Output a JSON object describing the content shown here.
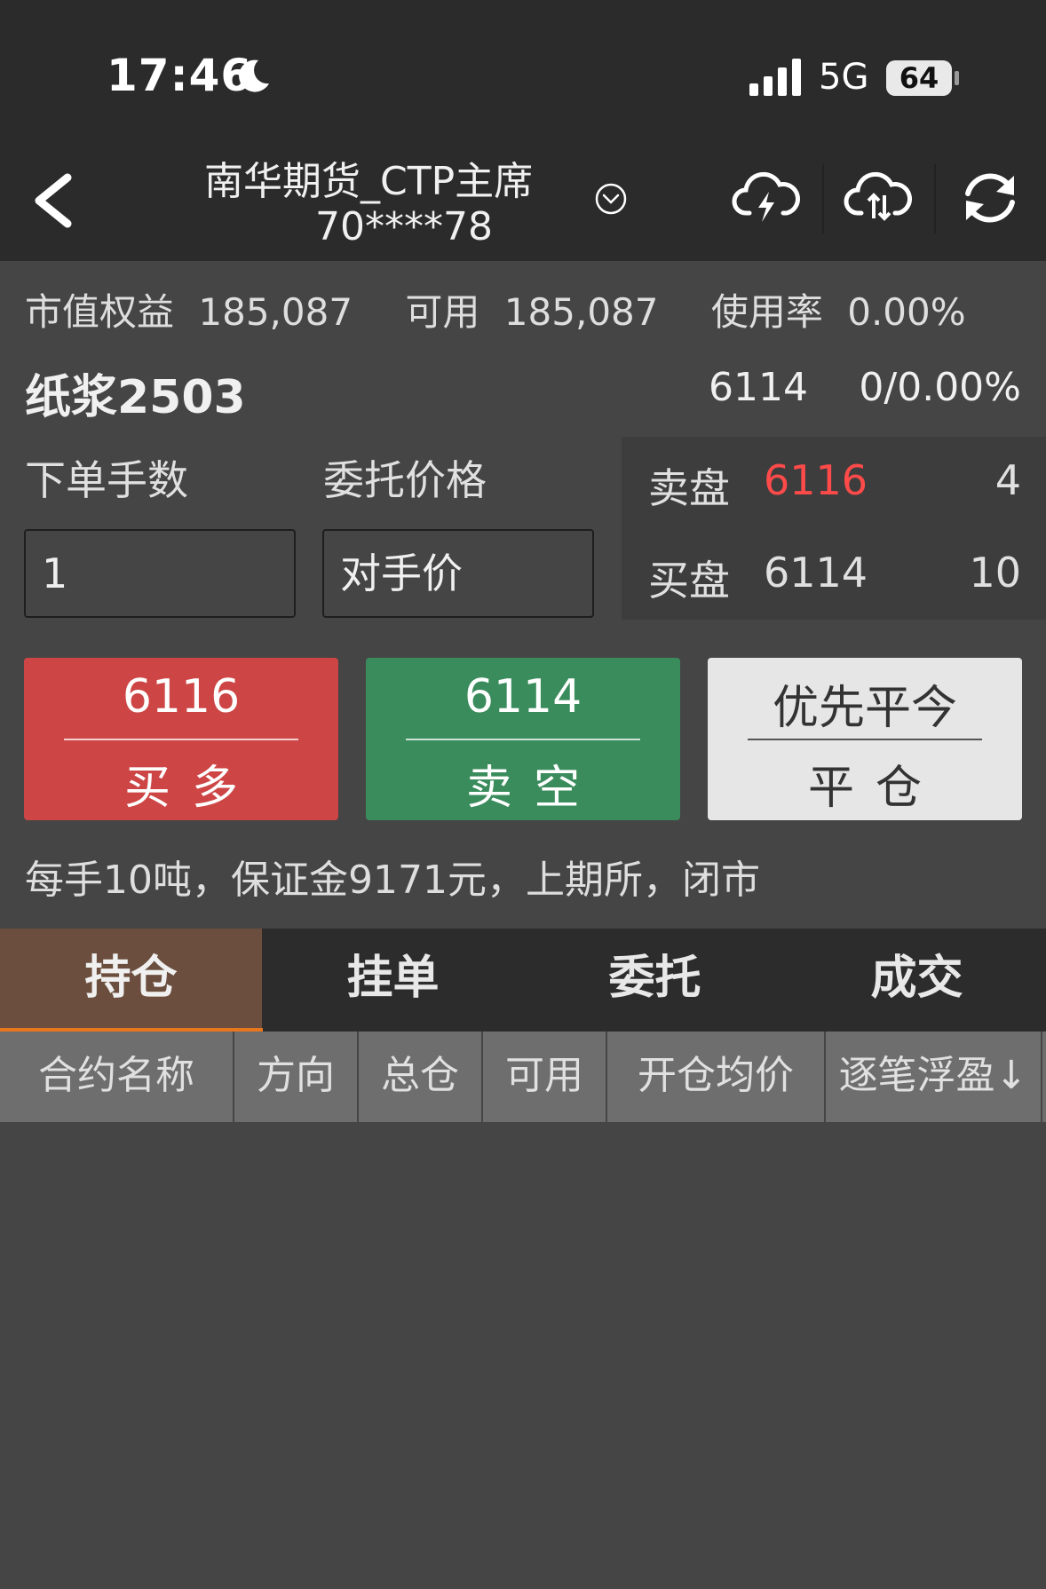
{
  "status_bar": {
    "time": "17:46",
    "network": "5G",
    "battery": "64"
  },
  "header": {
    "title": "南华期货_CTP主席",
    "account": "70****78"
  },
  "account_info": {
    "equity_label": "市值权益",
    "equity_value": "185,087",
    "available_label": "可用",
    "available_value": "185,087",
    "usage_label": "使用率",
    "usage_value": "0.00%"
  },
  "contract": {
    "name": "纸浆2503",
    "last_price": "6114",
    "change": "0/0.00%"
  },
  "order_form": {
    "quantity_label": "下单手数",
    "quantity_value": "1",
    "price_label": "委托价格",
    "price_value": "对手价"
  },
  "order_book": {
    "ask": {
      "label": "卖盘",
      "price": "6116",
      "qty": "4"
    },
    "bid": {
      "label": "买盘",
      "price": "6114",
      "qty": "10"
    }
  },
  "actions": {
    "buy": {
      "price": "6116",
      "label": "买多"
    },
    "sell": {
      "price": "6114",
      "label": "卖空"
    },
    "close": {
      "price": "优先平今",
      "label": "平仓"
    }
  },
  "contract_desc": "每手10吨，保证金9171元，上期所，闭市",
  "tabs": [
    "持仓",
    "挂单",
    "委托",
    "成交"
  ],
  "active_tab": "持仓",
  "positions_table": {
    "columns": [
      "合约名称",
      "方向",
      "总仓",
      "可用",
      "开仓均价",
      "逐笔浮盈↓"
    ]
  },
  "colors": {
    "buy": "#cd4545",
    "sell": "#3a8c5c",
    "ask_price": "#ff4a4a",
    "active_tab": "#6b4e3d",
    "tab_underline": "#e8761f"
  }
}
